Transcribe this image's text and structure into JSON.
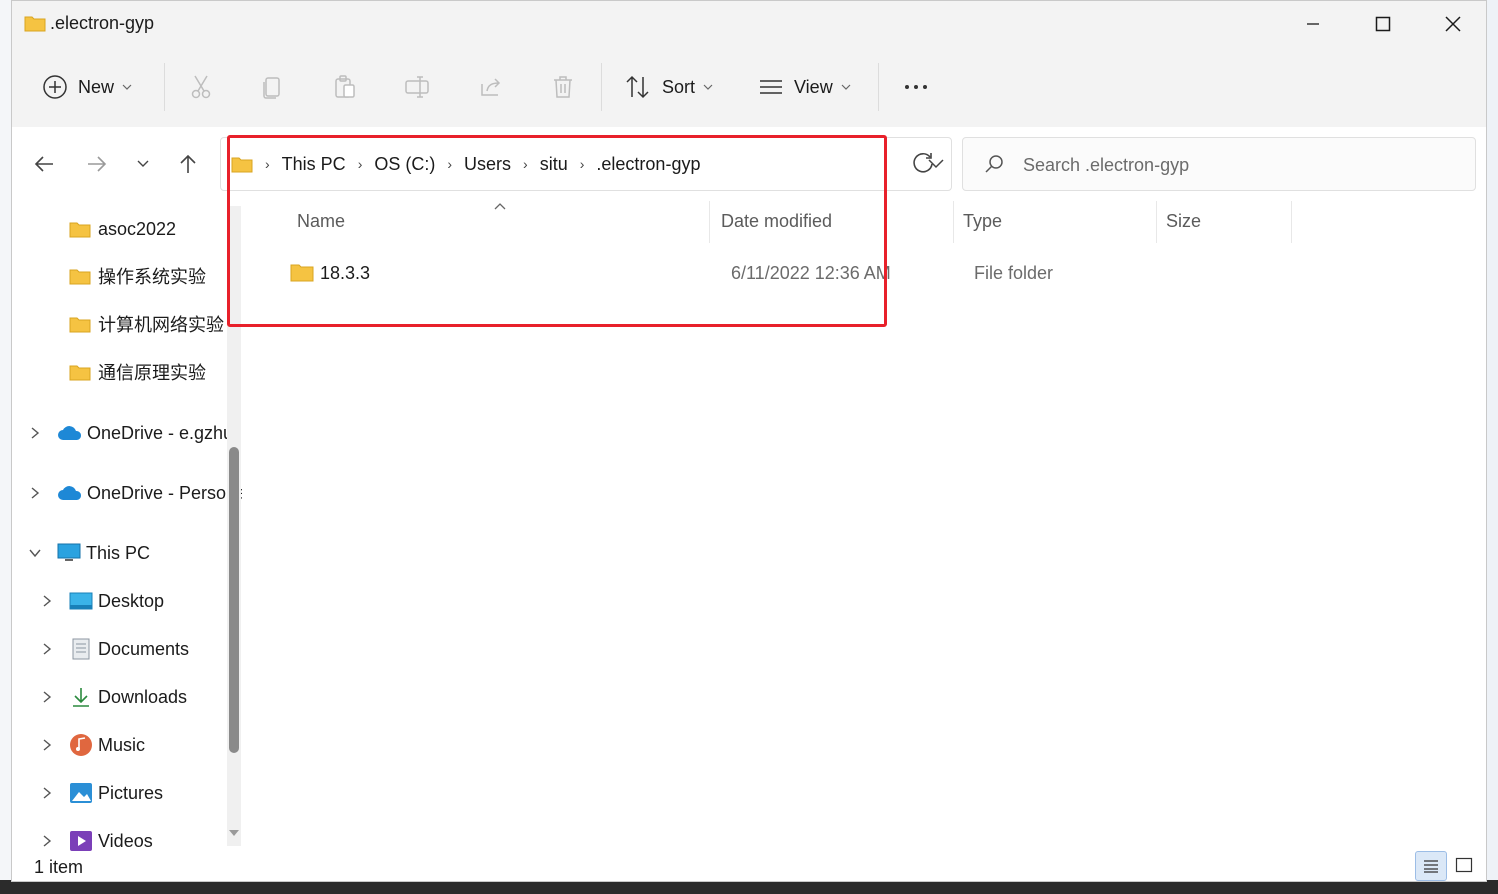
{
  "window": {
    "title": ".electron-gyp"
  },
  "toolbar": {
    "new_label": "New",
    "sort_label": "Sort",
    "view_label": "View",
    "icons": [
      "cut-icon",
      "copy-icon",
      "paste-icon",
      "rename-icon",
      "share-icon",
      "delete-icon"
    ]
  },
  "address": {
    "crumbs": [
      "This PC",
      "OS (C:)",
      "Users",
      "situ",
      ".electron-gyp"
    ]
  },
  "search": {
    "placeholder": "Search .electron-gyp"
  },
  "sidebar": {
    "pinned": [
      "asoc2022",
      "操作系统实验",
      "计算机网络实验",
      "通信原理实验"
    ],
    "onedrive": [
      "OneDrive - e.gzhu",
      "OneDrive - Personal"
    ],
    "this_pc": "This PC",
    "this_pc_children": [
      "Desktop",
      "Documents",
      "Downloads",
      "Music",
      "Pictures",
      "Videos"
    ]
  },
  "columns": {
    "name": "Name",
    "date": "Date modified",
    "type": "Type",
    "size": "Size"
  },
  "files": [
    {
      "name": "18.3.3",
      "date": "6/11/2022 12:36 AM",
      "type": "File folder",
      "size": ""
    }
  ],
  "status": {
    "count": "1 item"
  },
  "colors": {
    "highlight": "#e8202a",
    "folder": "#f5c342",
    "onedrive": "#1e88d6"
  }
}
